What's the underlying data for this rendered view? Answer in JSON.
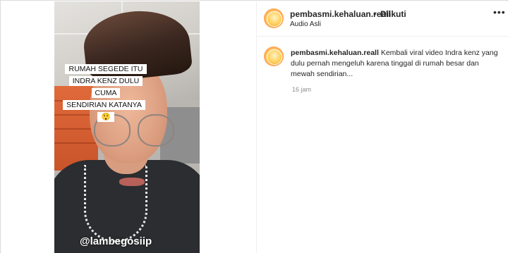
{
  "post": {
    "video": {
      "caption_lines": [
        "RUMAH SEGEDE ITU",
        "INDRA KENZ DULU CUMA",
        "SENDIRIAN KATANYA 😲"
      ],
      "watermark": "@lambegosiip",
      "sound_icon": "speaker-icon"
    },
    "header": {
      "username": "pembasmi.kehaluan.reall",
      "separator": "•",
      "follow_status": "Diikuti",
      "audio": "Audio Asli",
      "more_icon": "more-options-icon",
      "more_glyph": "•••"
    },
    "caption_comment": {
      "username": "pembasmi.kehaluan.reall",
      "text": "Kembali viral video Indra kenz yang dulu pernah mengeluh karena tinggal di rumah besar dan mewah sendirian...",
      "time": "16 jam"
    }
  },
  "colors": {
    "text": "#262626",
    "muted": "#8e8e8e",
    "border": "#dbdbdb",
    "sofa": "#d95e2f"
  }
}
